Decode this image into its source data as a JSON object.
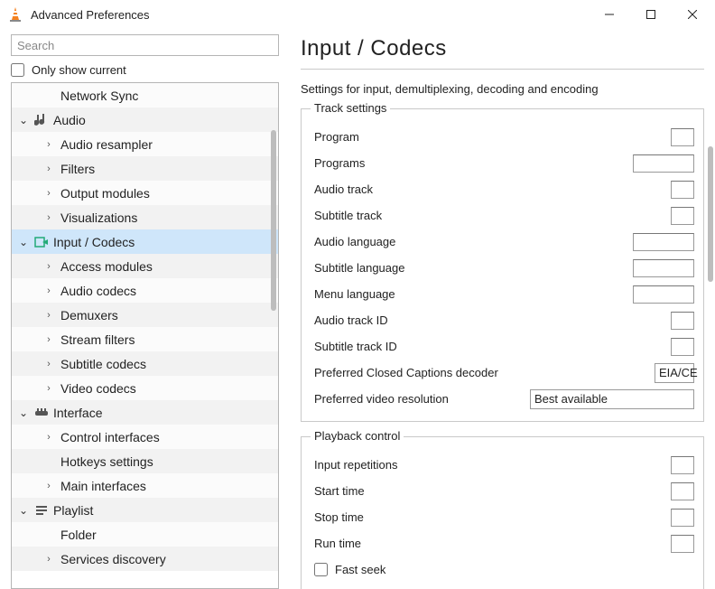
{
  "window": {
    "title": "Advanced Preferences"
  },
  "sidebar": {
    "search_placeholder": "Search",
    "only_show_current": "Only show current",
    "items": [
      {
        "type": "child",
        "label": "Network Sync",
        "expandable": false
      },
      {
        "type": "cat",
        "label": "Audio",
        "expanded": true,
        "icon": "audio"
      },
      {
        "type": "child",
        "label": "Audio resampler",
        "expandable": true
      },
      {
        "type": "child",
        "label": "Filters",
        "expandable": true
      },
      {
        "type": "child",
        "label": "Output modules",
        "expandable": true
      },
      {
        "type": "child",
        "label": "Visualizations",
        "expandable": true
      },
      {
        "type": "cat",
        "label": "Input / Codecs",
        "expanded": true,
        "icon": "input",
        "selected": true
      },
      {
        "type": "child",
        "label": "Access modules",
        "expandable": true
      },
      {
        "type": "child",
        "label": "Audio codecs",
        "expandable": true
      },
      {
        "type": "child",
        "label": "Demuxers",
        "expandable": true
      },
      {
        "type": "child",
        "label": "Stream filters",
        "expandable": true
      },
      {
        "type": "child",
        "label": "Subtitle codecs",
        "expandable": true
      },
      {
        "type": "child",
        "label": "Video codecs",
        "expandable": true
      },
      {
        "type": "cat",
        "label": "Interface",
        "expanded": true,
        "icon": "interface"
      },
      {
        "type": "child",
        "label": "Control interfaces",
        "expandable": true
      },
      {
        "type": "child",
        "label": "Hotkeys settings",
        "expandable": false
      },
      {
        "type": "child",
        "label": "Main interfaces",
        "expandable": true
      },
      {
        "type": "cat",
        "label": "Playlist",
        "expanded": true,
        "icon": "playlist"
      },
      {
        "type": "child",
        "label": "Folder",
        "expandable": false
      },
      {
        "type": "child",
        "label": "Services discovery",
        "expandable": true
      }
    ]
  },
  "panel": {
    "heading": "Input / Codecs",
    "subtitle": "Settings for input, demultiplexing, decoding and encoding",
    "groups": {
      "track": {
        "legend": "Track settings",
        "rows": [
          {
            "label": "Program",
            "ctl": "num-tiny"
          },
          {
            "label": "Programs",
            "ctl": "text-small"
          },
          {
            "label": "Audio track",
            "ctl": "num-tiny"
          },
          {
            "label": "Subtitle track",
            "ctl": "num-tiny"
          },
          {
            "label": "Audio language",
            "ctl": "text-small"
          },
          {
            "label": "Subtitle language",
            "ctl": "text-small"
          },
          {
            "label": "Menu language",
            "ctl": "text-small"
          },
          {
            "label": "Audio track ID",
            "ctl": "num-tiny"
          },
          {
            "label": "Subtitle track ID",
            "ctl": "num-tiny"
          },
          {
            "label": "Preferred Closed Captions decoder",
            "ctl": "select-narrow",
            "value": "EIA/CE"
          },
          {
            "label": "Preferred video resolution",
            "ctl": "select-wide",
            "value": "Best available"
          }
        ]
      },
      "playback": {
        "legend": "Playback control",
        "rows": [
          {
            "label": "Input repetitions",
            "ctl": "num-tiny"
          },
          {
            "label": "Start time",
            "ctl": "num-tiny"
          },
          {
            "label": "Stop time",
            "ctl": "num-tiny"
          },
          {
            "label": "Run time",
            "ctl": "num-tiny"
          },
          {
            "label": "Fast seek",
            "ctl": "checkbox"
          }
        ]
      }
    }
  }
}
